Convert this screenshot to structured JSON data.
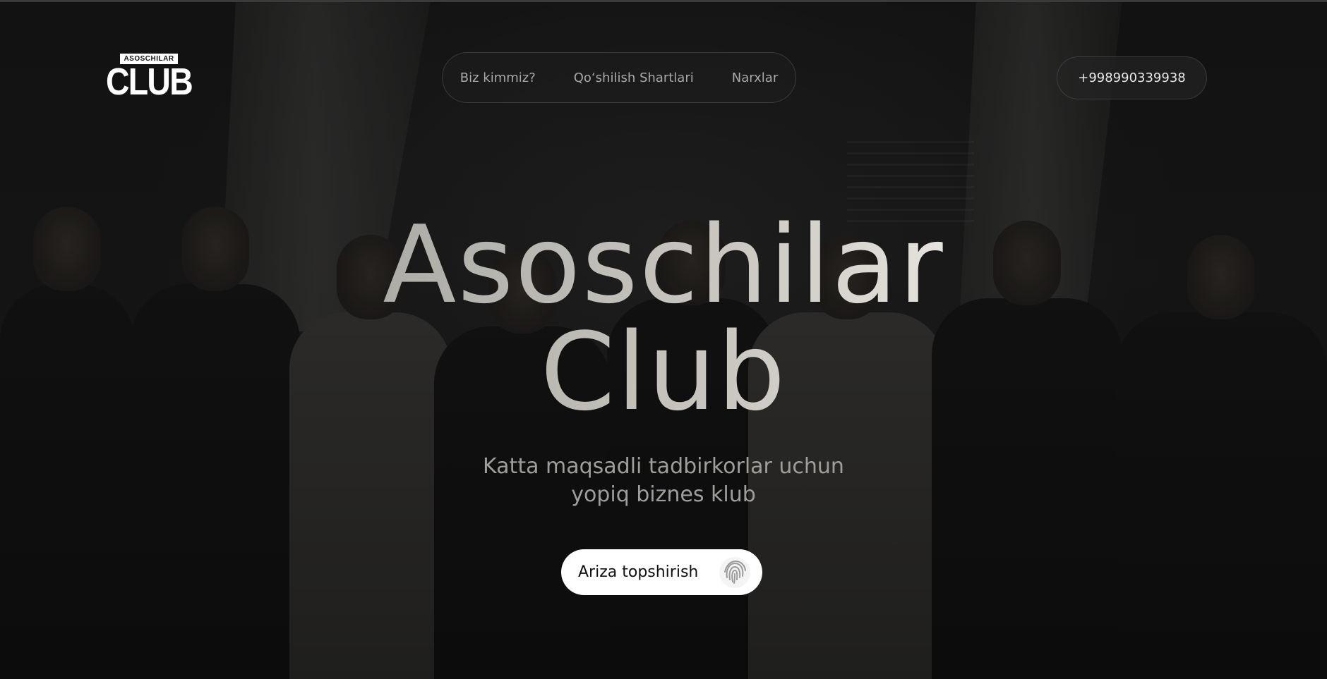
{
  "brand": {
    "logo_small": "ASOSCHILAR",
    "logo_big": "CLUB"
  },
  "nav": {
    "items": [
      {
        "label": "Biz kimmiz?"
      },
      {
        "label": "Qo‘shilish Shartlari"
      },
      {
        "label": "Narxlar"
      }
    ]
  },
  "contact": {
    "phone": "+998990339938"
  },
  "hero": {
    "title_line1": "Asoschilar",
    "title_line2": "Club",
    "subtitle_line1": "Katta maqsadli tadbirkorlar uchun",
    "subtitle_line2": "yopiq biznes klub",
    "cta_label": "Ariza topshirish",
    "cta_icon": "fingerprint-icon"
  },
  "colors": {
    "background": "#1a1a1a",
    "nav_text": "#a9a9a9",
    "cta_background": "#ffffff",
    "cta_text": "#111111",
    "subtitle": "#9f9e9a"
  }
}
